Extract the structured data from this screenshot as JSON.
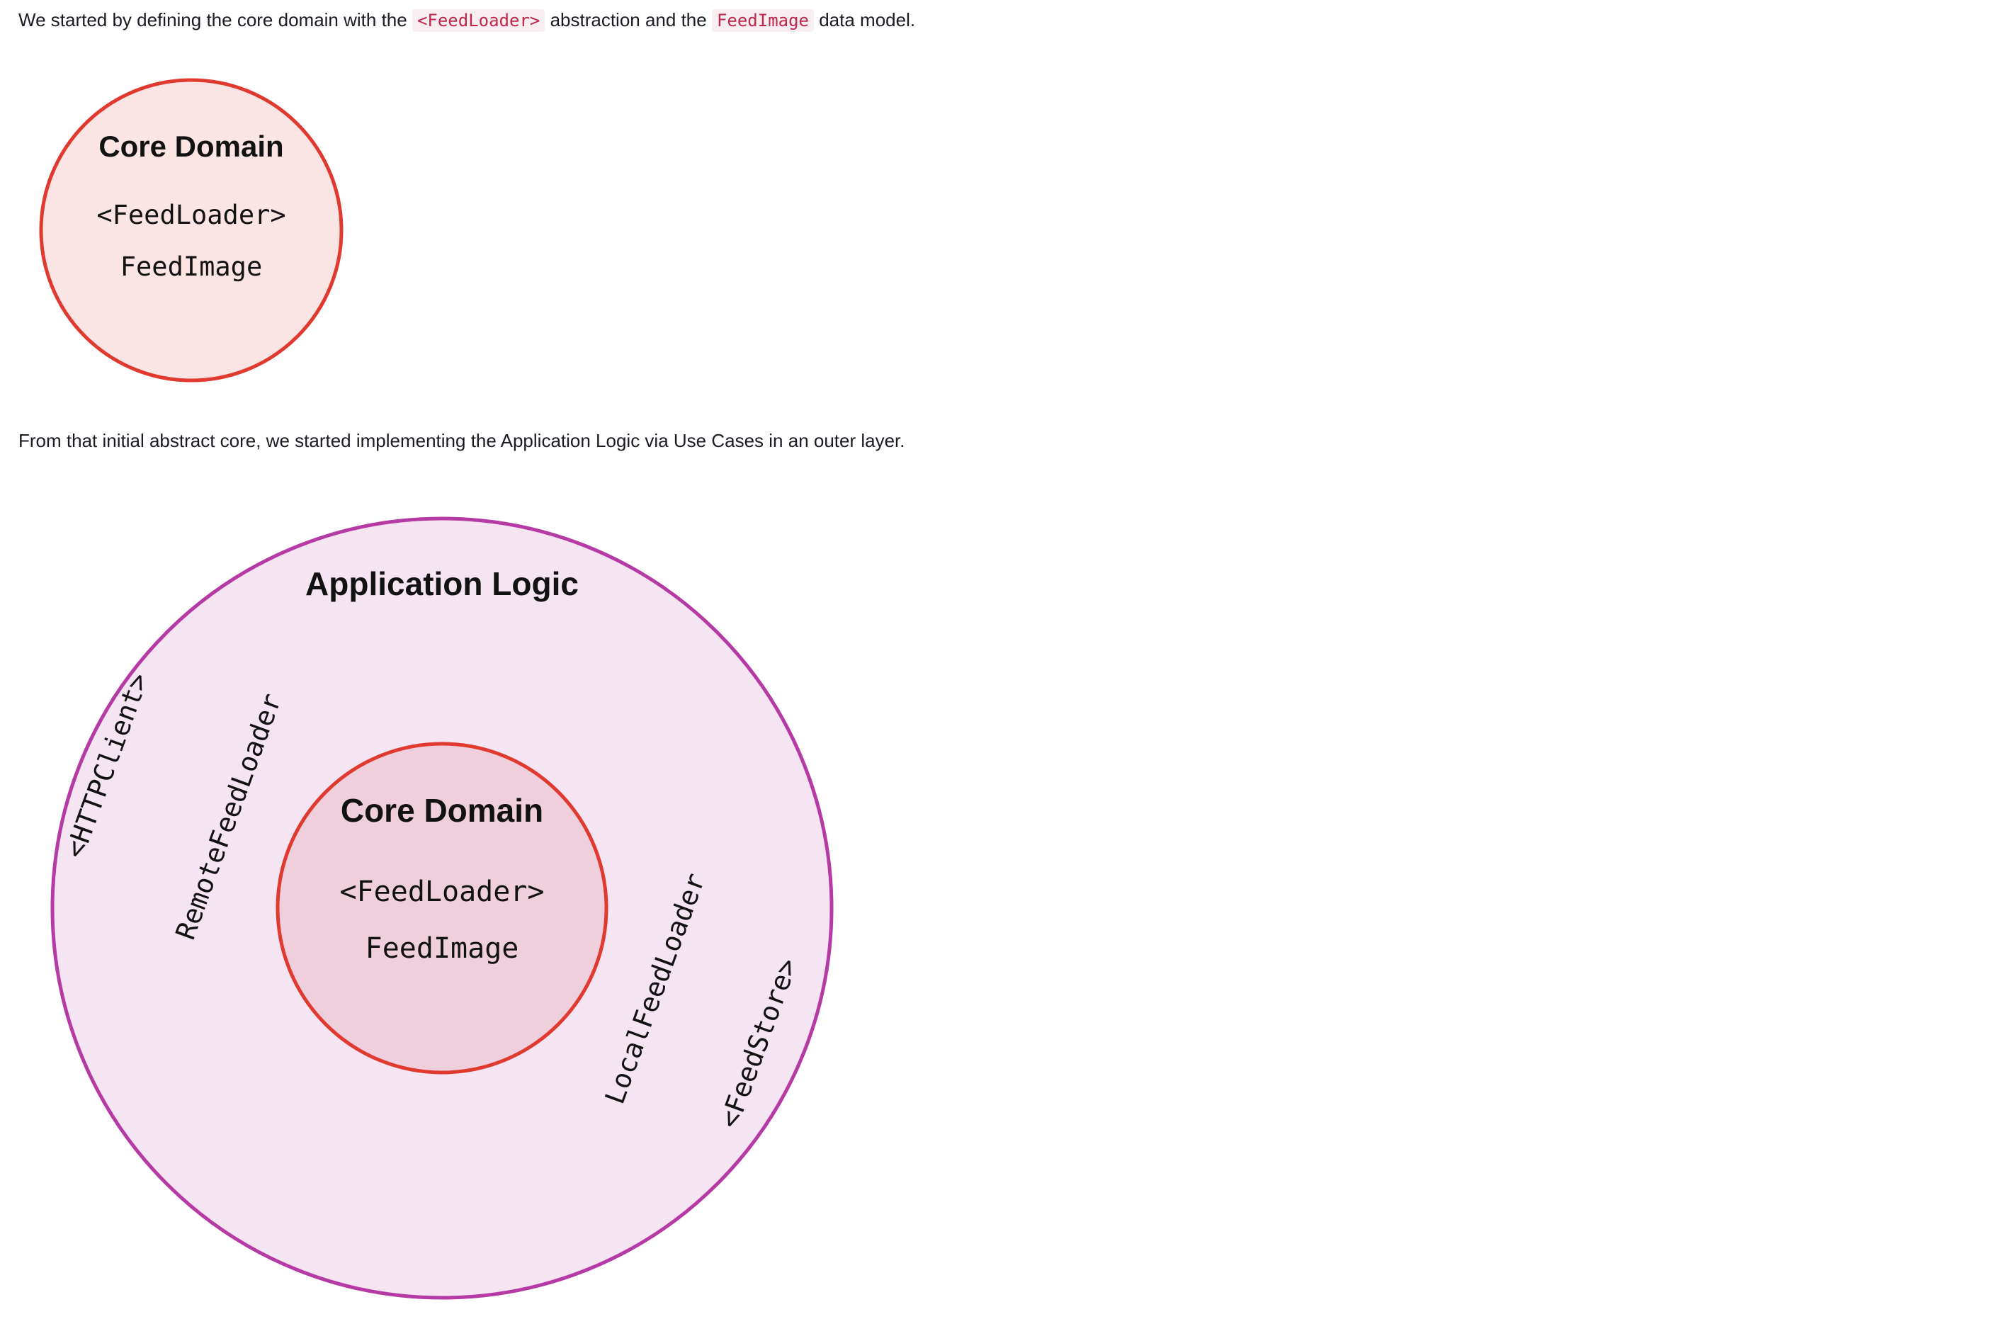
{
  "intro": {
    "before": "We started by defining the core domain with the ",
    "code1": "<FeedLoader>",
    "middle": " abstraction and the ",
    "code2": "FeedImage",
    "after": " data model."
  },
  "second_paragraph": "From that initial abstract core, we started implementing the Application Logic via Use Cases in an outer layer.",
  "diagram1": {
    "title": "Core Domain",
    "items": [
      "<FeedLoader>",
      "FeedImage"
    ],
    "colors": {
      "stroke": "#e03a30",
      "fill": "#fbe4e4"
    }
  },
  "diagram2": {
    "outer_title": "Application Logic",
    "outer_colors": {
      "stroke": "#b53aa4",
      "fill": "#f5e4f2"
    },
    "core": {
      "title": "Core Domain",
      "items": [
        "<FeedLoader>",
        "FeedImage"
      ],
      "colors": {
        "stroke": "#e03a30",
        "fill": "#f0cfdd"
      }
    },
    "labels": {
      "http_client": "<HTTPClient>",
      "remote_loader": "RemoteFeedLoader",
      "local_loader": "LocalFeedLoader",
      "feed_store": "<FeedStore>"
    }
  }
}
